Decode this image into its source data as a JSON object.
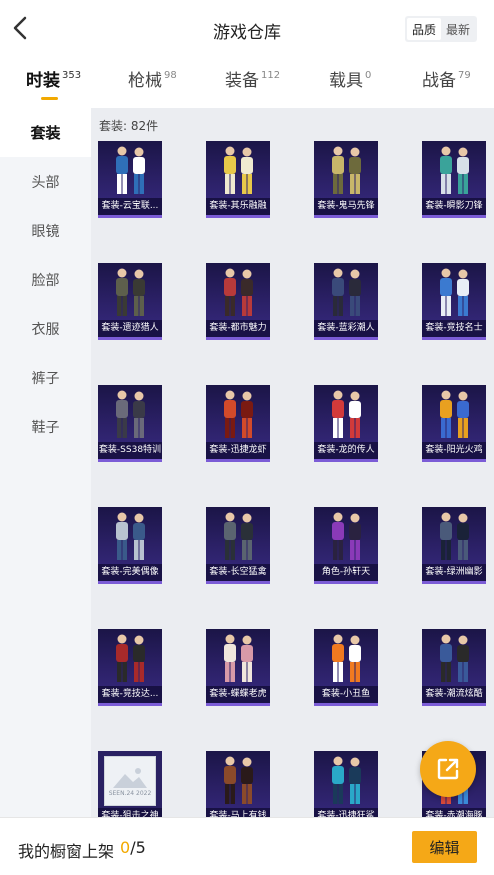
{
  "header": {
    "title": "游戏仓库",
    "sort": {
      "quality": "品质",
      "latest": "最新"
    }
  },
  "tabs": [
    {
      "label": "时装",
      "count": "353"
    },
    {
      "label": "枪械",
      "count": "98"
    },
    {
      "label": "装备",
      "count": "112"
    },
    {
      "label": "载具",
      "count": "0"
    },
    {
      "label": "战备",
      "count": "79"
    }
  ],
  "sidebar": [
    {
      "label": "套装"
    },
    {
      "label": "头部"
    },
    {
      "label": "眼镜"
    },
    {
      "label": "脸部"
    },
    {
      "label": "衣服"
    },
    {
      "label": "裤子"
    },
    {
      "label": "鞋子"
    }
  ],
  "content": {
    "count_text": "套装: 82件"
  },
  "items": [
    {
      "label": "套装-云宝联..."
    },
    {
      "label": "套装-其乐融融"
    },
    {
      "label": "套装-鬼马先锋"
    },
    {
      "label": "套装-瞬影刀锋"
    },
    {
      "label": "套装-遗迹猎人"
    },
    {
      "label": "套装-都市魅力"
    },
    {
      "label": "套装-蓝彩潮人"
    },
    {
      "label": "套装-竞技名士"
    },
    {
      "label": "套装-SS38特训"
    },
    {
      "label": "套装-迅捷龙虾"
    },
    {
      "label": "套装-龙的传人"
    },
    {
      "label": "套装-阳光火鸡"
    },
    {
      "label": "套装-完美偶像"
    },
    {
      "label": "套装-长空猛禽"
    },
    {
      "label": "角色-孙轩天"
    },
    {
      "label": "套装-绿洲幽影"
    },
    {
      "label": "套装-竞技达..."
    },
    {
      "label": "套装-蝶蝶老虎"
    },
    {
      "label": "套装-小丑鱼"
    },
    {
      "label": "套装-潮流炫酷"
    },
    {
      "label": "套装-狙击之神",
      "placeholder_text": "SEEN.24 2022"
    },
    {
      "label": "套装-马上有钱"
    },
    {
      "label": "套装-迅捷狂鲨"
    },
    {
      "label": "套装-赤潮海豚"
    }
  ],
  "bottom": {
    "text": "我的橱窗上架",
    "count": "0",
    "total": "/5",
    "edit": "编辑"
  },
  "colors": {
    "accent": "#f5a817",
    "card_bg": "#2c2168",
    "card_border": "#7b5cd6"
  }
}
